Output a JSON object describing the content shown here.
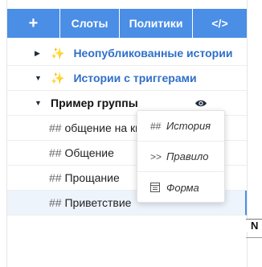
{
  "toolbar": {
    "add_label": "+",
    "slots_label": "Слоты",
    "policies_label": "Политики",
    "code_label": "</>"
  },
  "tree": {
    "unpublished_label": "Неопубликованные истории",
    "triggered_label": "Истории с триггерами",
    "group_label": "Пример группы",
    "stories": [
      {
        "hash": "##",
        "label": "общение на кн"
      },
      {
        "hash": "##",
        "label": "Общение"
      },
      {
        "hash": "##",
        "label": "Прощание"
      },
      {
        "hash": "##",
        "label": "Приветствие"
      }
    ]
  },
  "context_menu": {
    "items": [
      {
        "icon": "##",
        "label": "История"
      },
      {
        "icon": ">>",
        "label": "Правило"
      },
      {
        "icon": "form-icon",
        "label": "Форма"
      }
    ]
  },
  "outer": {
    "header_fragment": "N"
  },
  "colors": {
    "toolbar_bg": "#4a8ee6",
    "link_blue": "#2f6fc9",
    "sparkle": "#f3b400",
    "selected_bg": "#eef4fc"
  }
}
